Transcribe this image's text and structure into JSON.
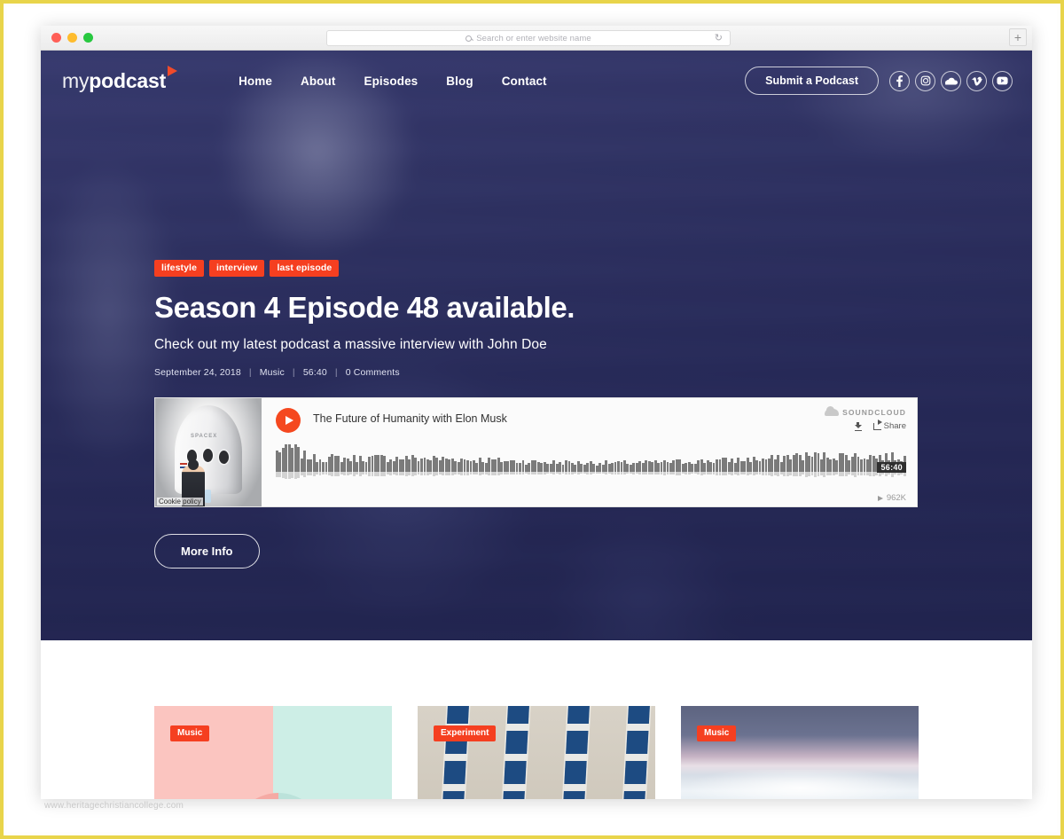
{
  "browser": {
    "search_placeholder": "Search or enter website name",
    "reload_icon": "reload-icon",
    "newtab_label": "+",
    "traffic_lights": [
      "close-red",
      "minimize-yellow",
      "maximize-green"
    ]
  },
  "site": {
    "logo": {
      "light": "my",
      "bold": "podcast",
      "mark": "play-triangle-icon"
    },
    "nav": [
      {
        "label": "Home"
      },
      {
        "label": "About"
      },
      {
        "label": "Episodes"
      },
      {
        "label": "Blog"
      },
      {
        "label": "Contact"
      }
    ],
    "submit_button": "Submit a Podcast",
    "socials": [
      {
        "name": "facebook-icon",
        "glyph": "f"
      },
      {
        "name": "instagram-icon",
        "glyph": "▢"
      },
      {
        "name": "soundcloud-icon",
        "glyph": "☁"
      },
      {
        "name": "vimeo-icon",
        "glyph": "v"
      },
      {
        "name": "youtube-icon",
        "glyph": "▶"
      }
    ]
  },
  "hero": {
    "tags": [
      "lifestyle",
      "interview",
      "last episode"
    ],
    "title": "Season 4 Episode 48 available.",
    "subtitle": "Check out my latest podcast a massive interview with John Doe",
    "meta": {
      "date": "September 24, 2018",
      "category": "Music",
      "duration": "56:40",
      "comments": "0 Comments",
      "separator": "|"
    },
    "more_button": "More Info"
  },
  "player": {
    "track_title": "The Future of Humanity with Elon Musk",
    "brand": "SOUNDCLOUD",
    "share_label": "Share",
    "download_label": "download-icon",
    "time_badge": "56:40",
    "plays": "962K",
    "cookie_policy": "Cookie policy",
    "artwork_text": "SPACEX",
    "play_label": "play-icon"
  },
  "cards": [
    {
      "badge": "Music",
      "image": "pastel-pink-mint-balloon"
    },
    {
      "badge": "Experiment",
      "image": "blue-window-facade-building"
    },
    {
      "badge": "Music",
      "image": "stormy-ocean-seascape"
    }
  ],
  "watermark": "www.heritagechristiancollege.com",
  "colors": {
    "accent_red": "#f53f20",
    "hero_navy": "#2f3264",
    "frame_gold": "#e8d44a",
    "play_orange": "#f5481f"
  }
}
